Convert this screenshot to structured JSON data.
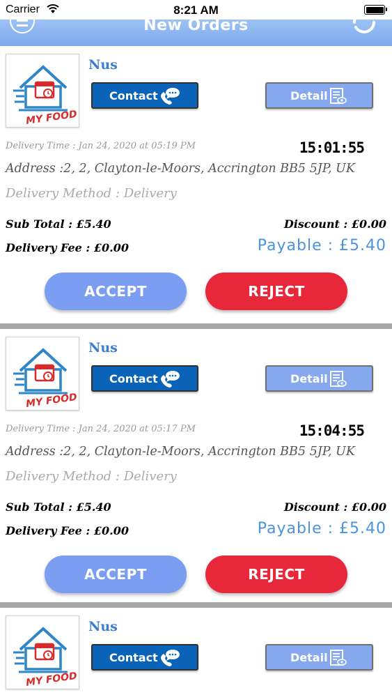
{
  "status_bar": {
    "carrier": "Carrier",
    "time": "8:21 AM"
  },
  "nav": {
    "title": "New Orders"
  },
  "colors": {
    "nav": "#8db4f0",
    "contact": "#0b63b8",
    "detail": "#86a8ef",
    "accept": "#7c9ef2",
    "reject": "#e8283a",
    "payable": "#4a93e0",
    "name": "#3a7fd0"
  },
  "logo": {
    "text": "MY FOOD"
  },
  "orders": [
    {
      "customer_name": "Nus",
      "contact_label": "Contact",
      "detail_label": "Detail",
      "delivery_time": "Delivery Time : Jan 24, 2020 at 05:19 PM",
      "timer": "15:01:55",
      "address": "Address :2, 2, Clayton-le-Moors, Accrington BB5 5JP, UK",
      "delivery_method": "Delivery Method : Delivery",
      "sub_total": "Sub Total : £5.40",
      "discount": "Discount : £0.00",
      "delivery_fee": "Delivery Fee : £0.00",
      "payable": "Payable : £5.40",
      "accept_label": "ACCEPT",
      "reject_label": "REJECT"
    },
    {
      "customer_name": "Nus",
      "contact_label": "Contact",
      "detail_label": "Detail",
      "delivery_time": "Delivery Time : Jan 24, 2020 at 05:17 PM",
      "timer": "15:04:55",
      "address": "Address :2, 2, Clayton-le-Moors, Accrington BB5 5JP, UK",
      "delivery_method": "Delivery Method : Delivery",
      "sub_total": "Sub Total : £5.40",
      "discount": "Discount : £0.00",
      "delivery_fee": "Delivery Fee : £0.00",
      "payable": "Payable : £5.40",
      "accept_label": "ACCEPT",
      "reject_label": "REJECT"
    },
    {
      "customer_name": "Nus",
      "contact_label": "Contact",
      "detail_label": "Detail"
    }
  ]
}
